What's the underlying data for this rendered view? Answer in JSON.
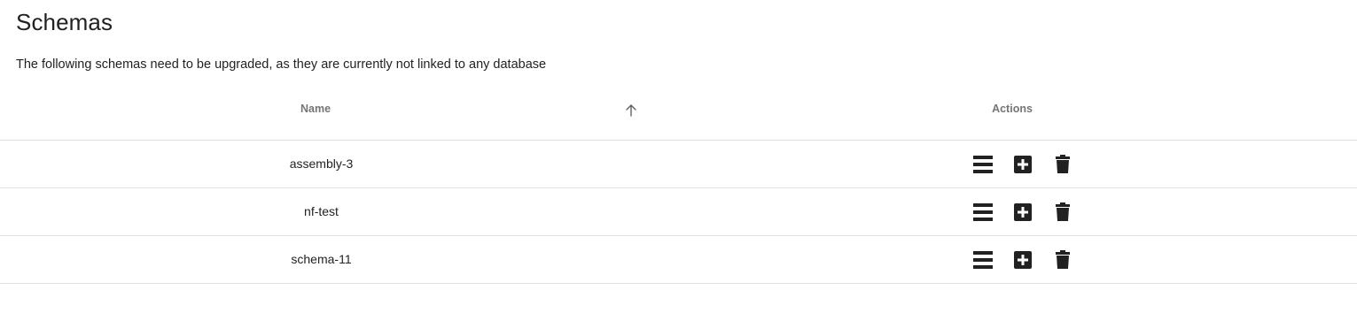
{
  "page": {
    "title": "Schemas",
    "description": "The following schemas need to be upgraded, as they are currently not linked to any database"
  },
  "table": {
    "columns": {
      "name": "Name",
      "actions": "Actions"
    },
    "sort": {
      "column": "Name",
      "direction": "ascending",
      "icon": "arrow-up-icon"
    },
    "rows": [
      {
        "name": "assembly-3"
      },
      {
        "name": "nf-test"
      },
      {
        "name": "schema-11"
      }
    ],
    "row_action_icons": [
      "list-icon",
      "add-box-icon",
      "trash-icon"
    ]
  },
  "colors": {
    "text": "#212121",
    "header_text": "#757575",
    "icon": "#212121",
    "divider": "#e0e0e0"
  }
}
